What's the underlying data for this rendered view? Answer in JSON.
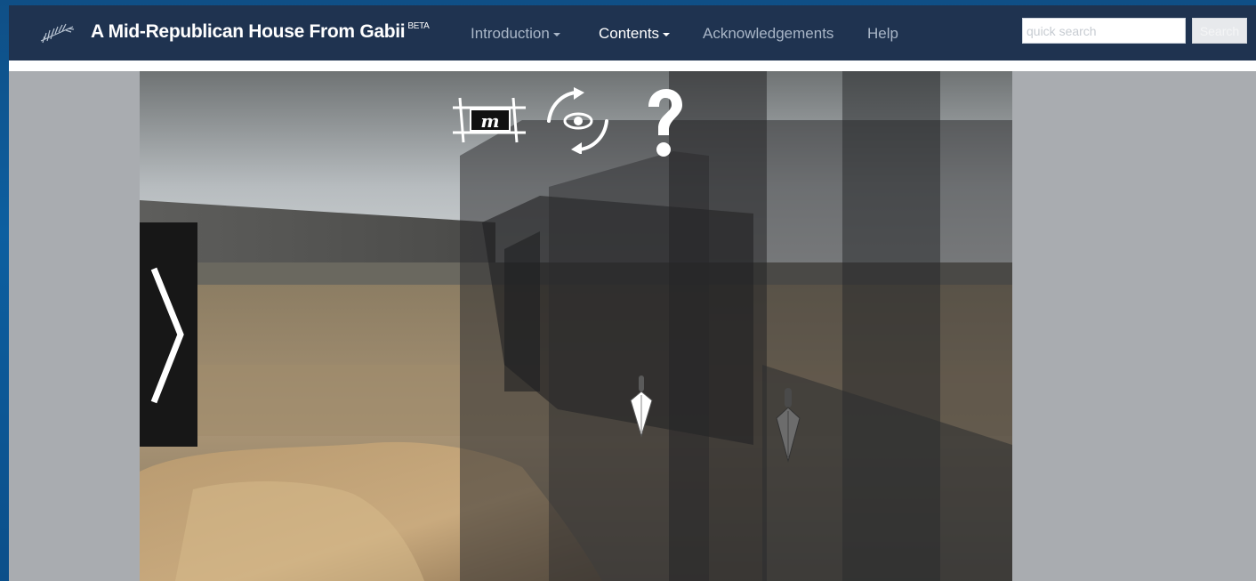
{
  "navbar": {
    "title": "A Mid-Republican House From Gabii",
    "title_badge": "BETA",
    "items": [
      {
        "label": "Introduction",
        "dropdown": true
      },
      {
        "label": "Contents",
        "dropdown": true
      },
      {
        "label": "Acknowledgements",
        "dropdown": false
      },
      {
        "label": "Help",
        "dropdown": false
      }
    ]
  },
  "search": {
    "placeholder": "quick search",
    "value": "",
    "button_label": "Search"
  },
  "viewer": {
    "toolbar_icons": [
      "map-icon",
      "rotate-view-icon",
      "help-question-icon"
    ],
    "side_panel_icon": "chevron-right-icon",
    "markers": [
      "trowel-marker-icon",
      "trowel-marker-icon"
    ]
  },
  "colors": {
    "navbar_bg": "#1f3350",
    "page_border": "#0d5fa0",
    "content_bg": "#a9acb0",
    "nav_text": "#a9b6c7"
  }
}
